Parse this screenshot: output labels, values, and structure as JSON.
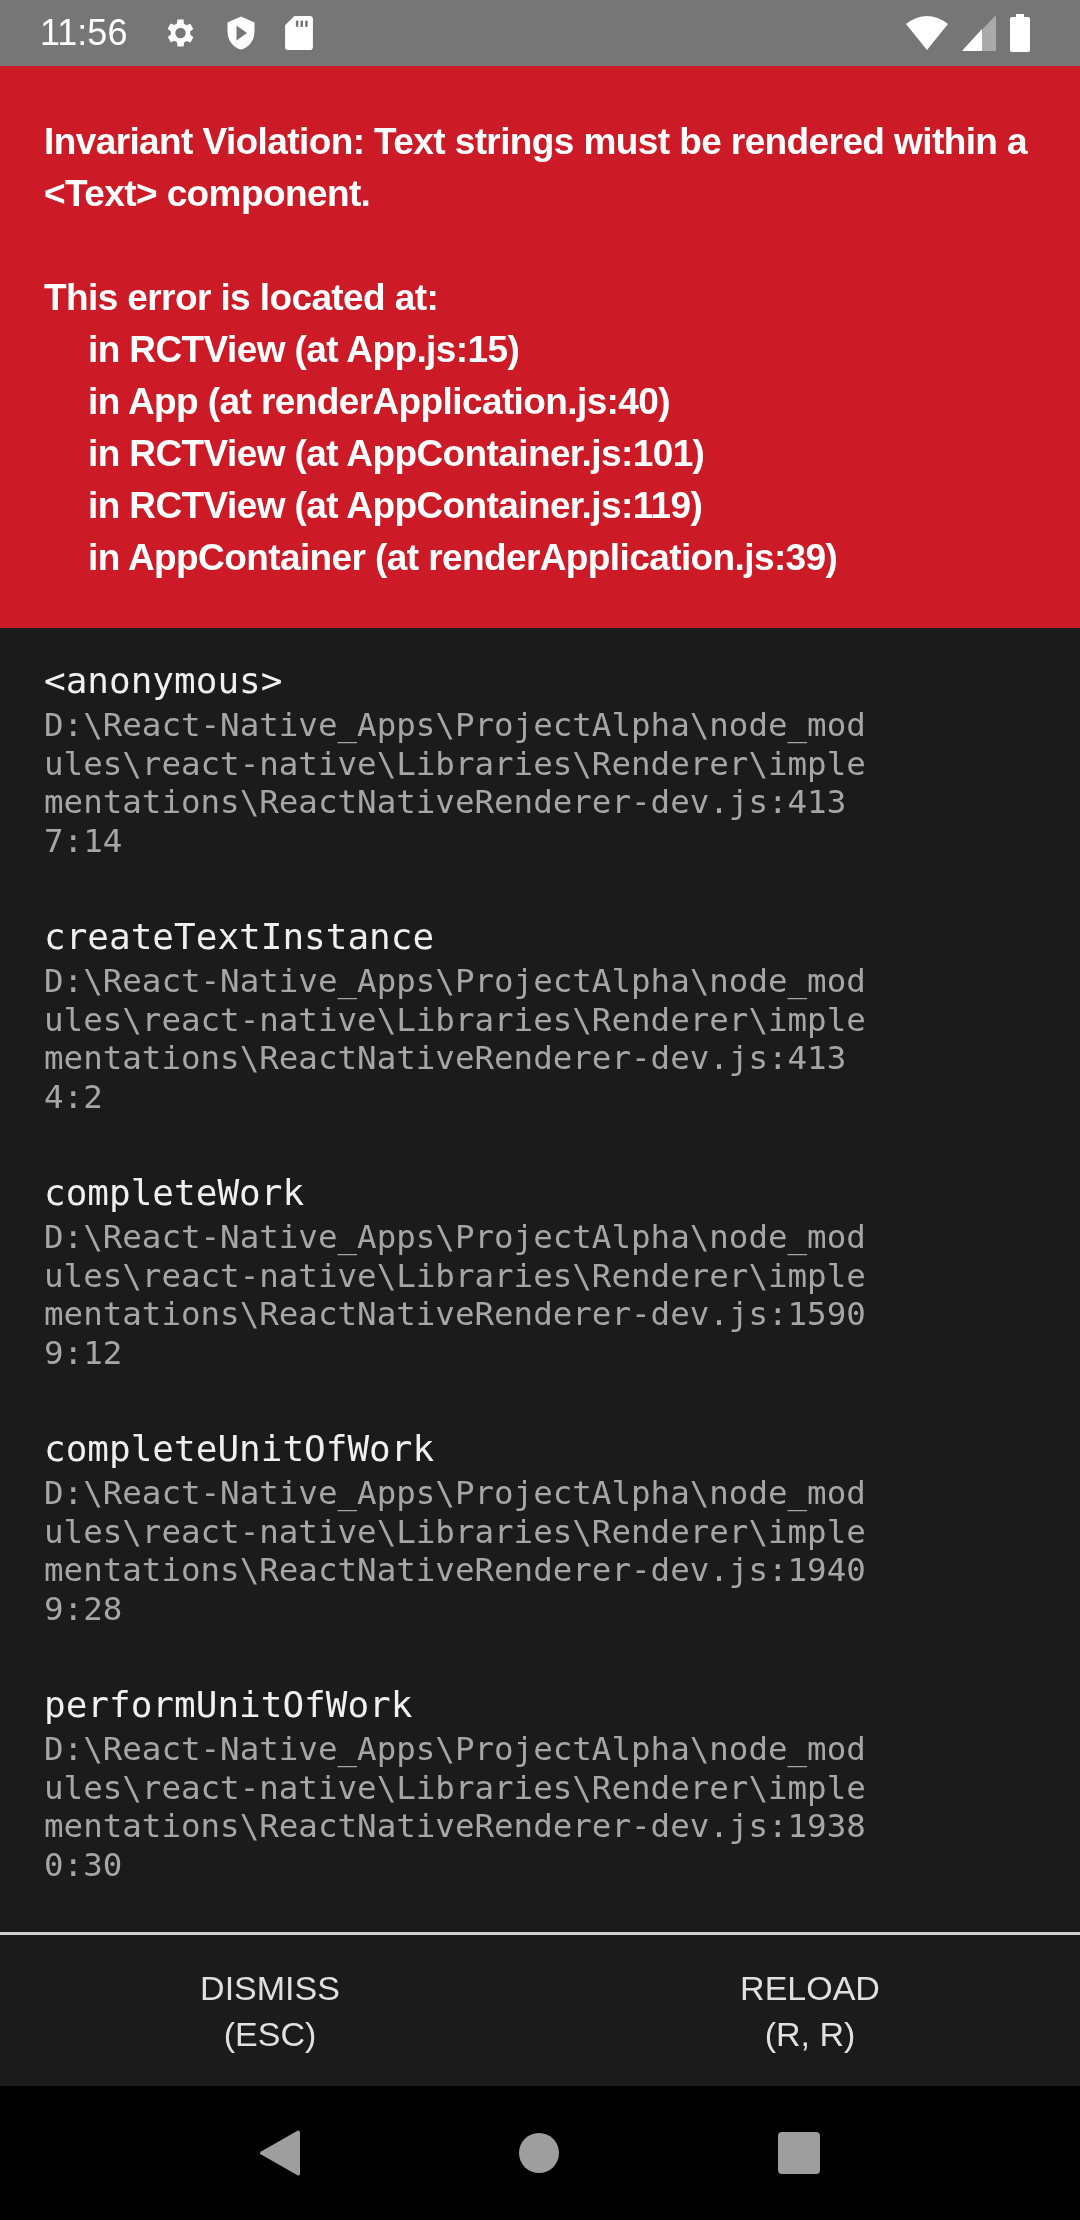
{
  "status_bar": {
    "time": "11:56"
  },
  "error": {
    "message": "Invariant Violation: Text strings must be rendered within a <Text> component.",
    "location_heading": "This error is located at:",
    "component_stack": [
      "in RCTView (at App.js:15)",
      "in App (at renderApplication.js:40)",
      "in RCTView (at AppContainer.js:101)",
      "in RCTView (at AppContainer.js:119)",
      "in AppContainer (at renderApplication.js:39)"
    ]
  },
  "stack_frames": [
    {
      "method": "<anonymous>",
      "location": "D:\\React-Native_Apps\\ProjectAlpha\\node_modules\\react-native\\Libraries\\Renderer\\implementations\\ReactNativeRenderer-dev.js:4137:14"
    },
    {
      "method": "createTextInstance",
      "location": "D:\\React-Native_Apps\\ProjectAlpha\\node_modules\\react-native\\Libraries\\Renderer\\implementations\\ReactNativeRenderer-dev.js:4134:2"
    },
    {
      "method": "completeWork",
      "location": "D:\\React-Native_Apps\\ProjectAlpha\\node_modules\\react-native\\Libraries\\Renderer\\implementations\\ReactNativeRenderer-dev.js:15909:12"
    },
    {
      "method": "completeUnitOfWork",
      "location": "D:\\React-Native_Apps\\ProjectAlpha\\node_modules\\react-native\\Libraries\\Renderer\\implementations\\ReactNativeRenderer-dev.js:19409:28"
    },
    {
      "method": "performUnitOfWork",
      "location": "D:\\React-Native_Apps\\ProjectAlpha\\node_modules\\react-native\\Libraries\\Renderer\\implementations\\ReactNativeRenderer-dev.js:19380:30"
    }
  ],
  "buttons": [
    {
      "label": "DISMISS",
      "shortcut": "(ESC)"
    },
    {
      "label": "RELOAD",
      "shortcut": "(R, R)"
    }
  ]
}
